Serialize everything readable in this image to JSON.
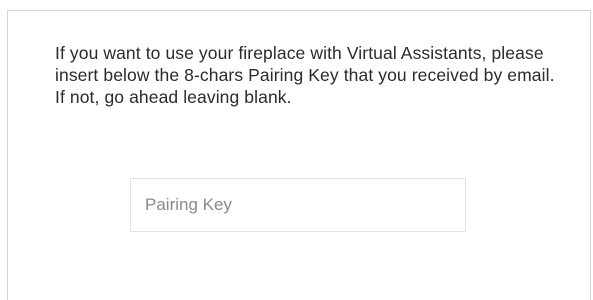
{
  "dialog": {
    "message": "If you want to use your fireplace with Virtual Assistants, please insert below the 8-chars Pairing Key that you received by email. If not, go ahead leaving blank."
  },
  "pairing_key": {
    "placeholder": "Pairing Key",
    "value": ""
  }
}
